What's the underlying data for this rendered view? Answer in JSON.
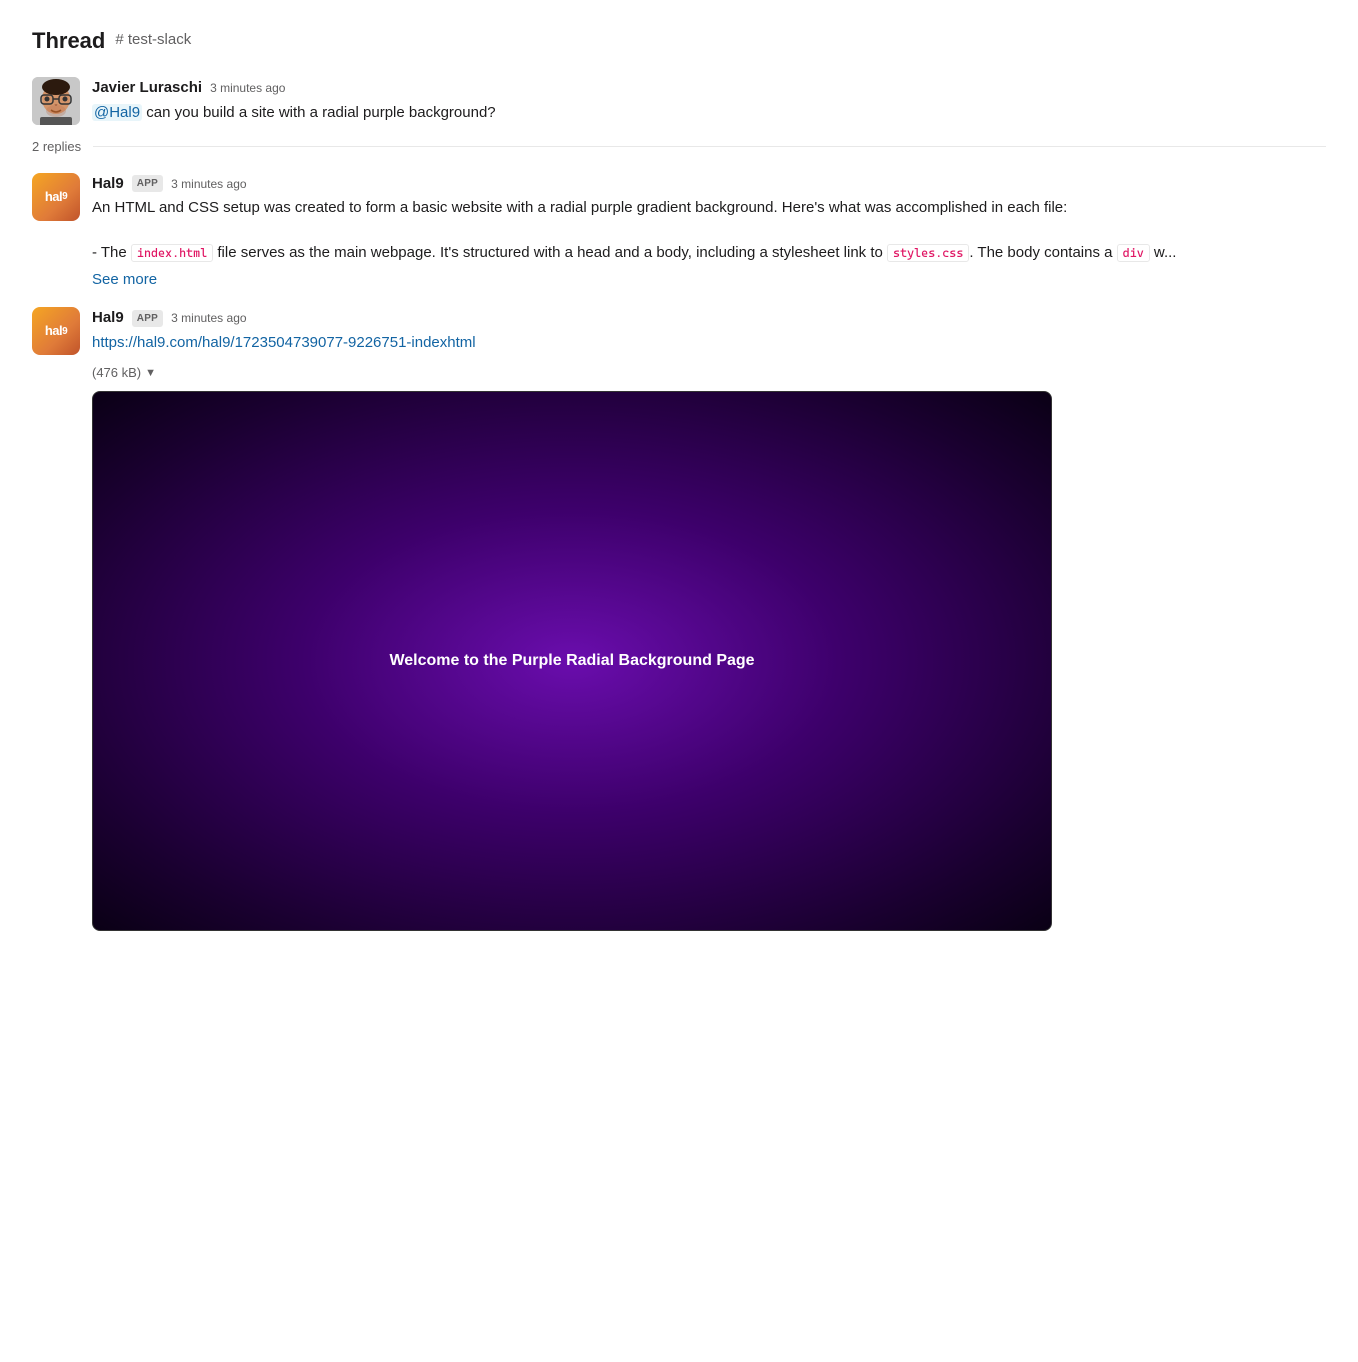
{
  "header": {
    "title": "Thread",
    "channel": "# test-slack"
  },
  "messages": [
    {
      "id": "msg1",
      "author": "Javier Luraschi",
      "time": "3 minutes ago",
      "is_app": false,
      "avatar_type": "javier",
      "text_parts": [
        {
          "type": "mention",
          "text": "@Hal9"
        },
        {
          "type": "text",
          "text": " can you build a site with a radial purple background?"
        }
      ]
    }
  ],
  "replies_label": "2 replies",
  "hal9_messages": [
    {
      "id": "hal9msg1",
      "author": "Hal9",
      "time": "3 minutes ago",
      "is_app": true,
      "app_badge": "APP",
      "body_text": "An HTML and CSS setup was created to form a basic website with a radial purple gradient background. Here's what was accomplished in each file:",
      "body_detail": "- The ",
      "code1": "index.html",
      "body_detail2": " file serves as the main webpage. It's structured with a head and a body, including a stylesheet link to ",
      "code2": "styles.css",
      "body_detail3": ". The body contains a ",
      "code3": "div",
      "body_detail4": " w...",
      "see_more": "See more"
    },
    {
      "id": "hal9msg2",
      "author": "Hal9",
      "time": "3 minutes ago",
      "is_app": true,
      "app_badge": "APP",
      "link": "https://hal9.com/hal9/1723504739077-9226751-indexhtml",
      "file_info": "(476 kB)",
      "preview_text": "Welcome to the Purple Radial Background Page"
    }
  ],
  "colors": {
    "mention_text": "#1264a3",
    "mention_bg": "#e8f5fa",
    "link": "#1264a3",
    "code_text": "#e01563",
    "code_border": "#e8e8e8"
  }
}
